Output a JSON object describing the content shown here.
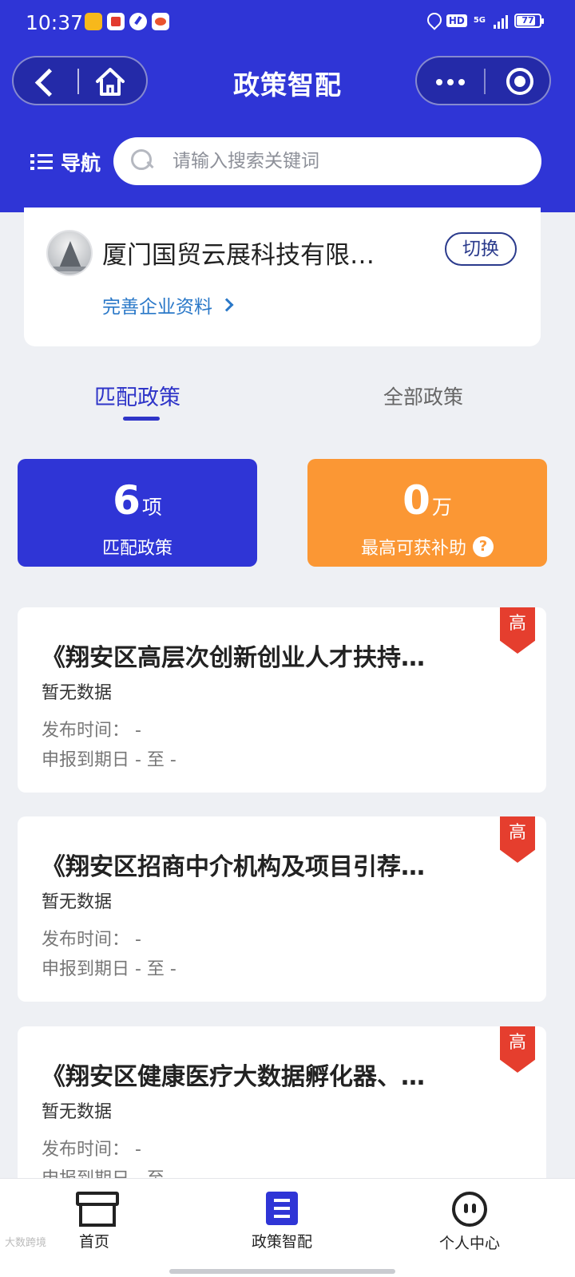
{
  "status_bar": {
    "time": "10:37",
    "network": "5G",
    "hd": "HD",
    "battery": "77"
  },
  "header": {
    "title": "政策智配",
    "nav_label": "导航",
    "search_placeholder": "请输入搜索关键词"
  },
  "company": {
    "name": "厦门国贸云展科技有限…",
    "switch_label": "切换",
    "complete_link": "完善企业资料"
  },
  "tabs": [
    {
      "label": "匹配政策",
      "active": true
    },
    {
      "label": "全部政策",
      "active": false
    }
  ],
  "stats": {
    "matched": {
      "value": "6",
      "unit": "项",
      "label": "匹配政策",
      "color": "#2f35d6"
    },
    "subsidy": {
      "value": "0",
      "unit": "万",
      "label": "最高可获补助",
      "color": "#fb9734"
    }
  },
  "policies": [
    {
      "title": "《翔安区高层次创新创业人才扶持…",
      "desc": "暂无数据",
      "publish": "发布时间：  -",
      "deadline": "申报到期日 - 至 -",
      "badge": "高"
    },
    {
      "title": "《翔安区招商中介机构及项目引荐…",
      "desc": "暂无数据",
      "publish": "发布时间：  -",
      "deadline": "申报到期日 - 至 -",
      "badge": "高"
    },
    {
      "title": "《翔安区健康医疗大数据孵化器、…",
      "desc": "暂无数据",
      "publish": "发布时间：  -",
      "deadline": "申报到期日 - 至 -",
      "badge": "高"
    }
  ],
  "bottom_nav": [
    {
      "label": "首页",
      "icon": "box-icon"
    },
    {
      "label": "政策智配",
      "icon": "document-icon",
      "active": true
    },
    {
      "label": "个人中心",
      "icon": "face-icon"
    }
  ],
  "watermark": "大数跨境"
}
